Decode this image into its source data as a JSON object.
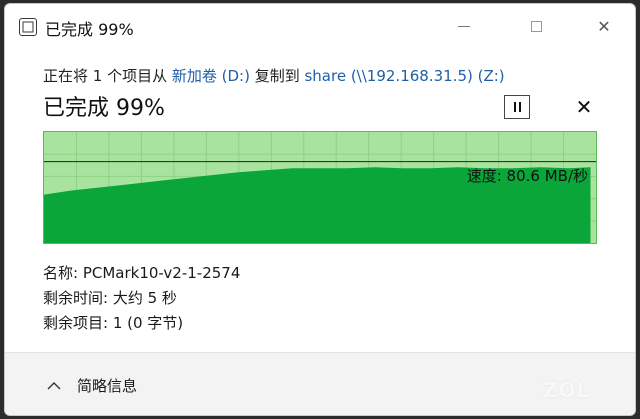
{
  "window": {
    "title": "已完成 99%"
  },
  "copy": {
    "prefix": "正在将 1 个项目从 ",
    "source": "新加卷 (D:)",
    "middle": " 复制到 ",
    "destination": "share (\\\\192.168.31.5) (Z:)"
  },
  "progress": {
    "title": "已完成 99%",
    "percent": 99,
    "speed_label": "速度: 80.6 MB/秒"
  },
  "details": {
    "name": "名称: PCMark10-v2-1-2574",
    "time_remaining": "剩余时间: 大约 5 秒",
    "items_remaining": "剩余项目: 1 (0 字节)"
  },
  "footer": {
    "less_details": "简略信息"
  },
  "watermark": "ZOL",
  "colors": {
    "graph_bg": "#a8e39f",
    "graph_fill": "#0aa63a",
    "graph_border": "#5cb85c",
    "link": "#1f5fa8"
  },
  "chart_data": {
    "type": "area",
    "x": [
      0,
      5,
      10,
      15,
      20,
      25,
      30,
      35,
      40,
      45,
      50,
      55,
      60,
      65,
      70,
      75,
      80,
      85,
      90,
      95,
      99
    ],
    "values": [
      48,
      52,
      55,
      58,
      61,
      64,
      67,
      70,
      72,
      74,
      74,
      74,
      75,
      74,
      74,
      75,
      74,
      74,
      75,
      74,
      75
    ],
    "current_speed": 80.6,
    "ylim": [
      0,
      110
    ],
    "grid": true
  }
}
